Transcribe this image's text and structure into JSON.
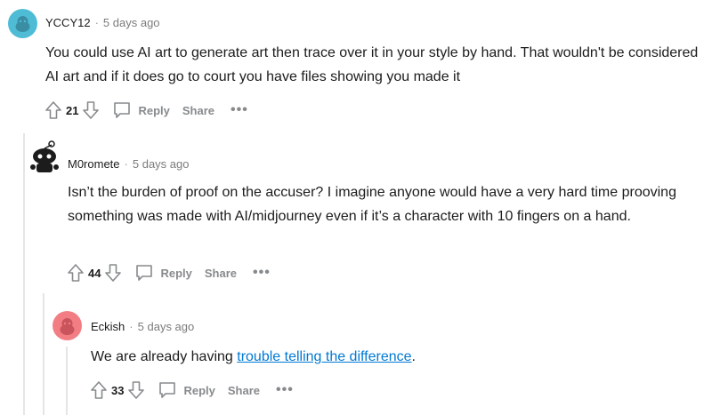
{
  "comments": [
    {
      "author": "YCCY12",
      "separator": "·",
      "time": "5 days ago",
      "text": "You could use AI art to generate art then trace over it in your style by hand. That wouldn't be considered AI art and if it does go to court you have files showing you made it",
      "votes": "21",
      "reply": "Reply",
      "share": "Share",
      "more": "•••",
      "avatar_color": "#4fbcd6"
    },
    {
      "author": "M0romete",
      "separator": "·",
      "time": "5 days ago",
      "text": "Isn’t the burden of proof on the accuser? I imagine anyone would have a very hard time prooving something was made with AI/midjourney even if it’s a character with 10 fingers on a hand.",
      "votes": "44",
      "reply": "Reply",
      "share": "Share",
      "more": "•••",
      "avatar_color": "#1c1c1c"
    },
    {
      "author": "Eckish",
      "separator": "·",
      "time": "5 days ago",
      "text_before": "We are already having ",
      "link": "trouble telling the difference",
      "text_after": ".",
      "votes": "33",
      "reply": "Reply",
      "share": "Share",
      "more": "•••",
      "avatar_color": "#f27e84"
    }
  ],
  "icons": {
    "upvote": "upvote-arrow-icon",
    "downvote": "downvote-arrow-icon",
    "reply": "speech-bubble-icon"
  }
}
